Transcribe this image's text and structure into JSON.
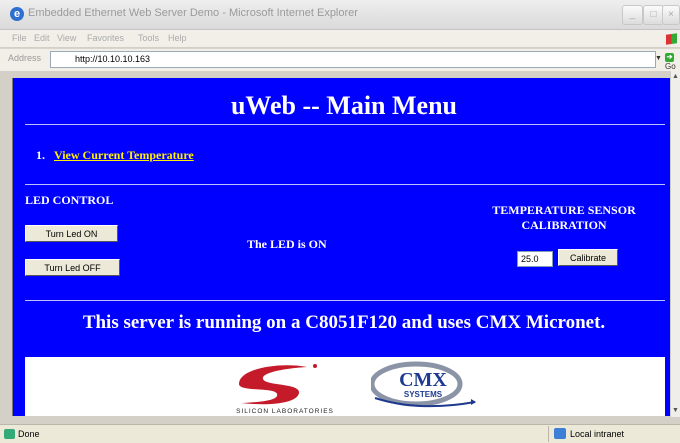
{
  "window": {
    "title": "Embedded Ethernet Web Server Demo - Microsoft Internet Explorer",
    "controls": {
      "minimize": "_",
      "maximize": "□",
      "close": "×"
    }
  },
  "menubar": {
    "items": [
      "File",
      "Edit",
      "View",
      "Favorites",
      "Tools",
      "Help"
    ]
  },
  "address_bar": {
    "label": "Address",
    "url": "http://10.10.10.163",
    "go_label": "Go"
  },
  "page": {
    "title": "uWeb -- Main Menu",
    "menu_number": "1.",
    "menu_link": "View Current Temperature",
    "led_control_title": "LED CONTROL",
    "led_on_button": "Turn Led ON",
    "led_off_button": "Turn Led OFF",
    "led_status": "The LED is ON",
    "temp_calibration_line1": "TEMPERATURE SENSOR",
    "temp_calibration_line2": "CALIBRATION",
    "calibration_value": "25.0",
    "calibrate_button": "Calibrate",
    "footer_text": "This server is running on a C8051F120 and uses CMX Micronet.",
    "silabs_logo_text": "SILICON LABORATORIES",
    "cmx_logo_text": "CMX",
    "cmx_logo_subtext": "SYSTEMS"
  },
  "statusbar": {
    "status": "Done",
    "zone": "Local intranet"
  },
  "colors": {
    "page_background": "#0000ff",
    "link": "#fff000",
    "silabs_red": "#c41a2a",
    "cmx_blue": "#1d3a8f"
  }
}
